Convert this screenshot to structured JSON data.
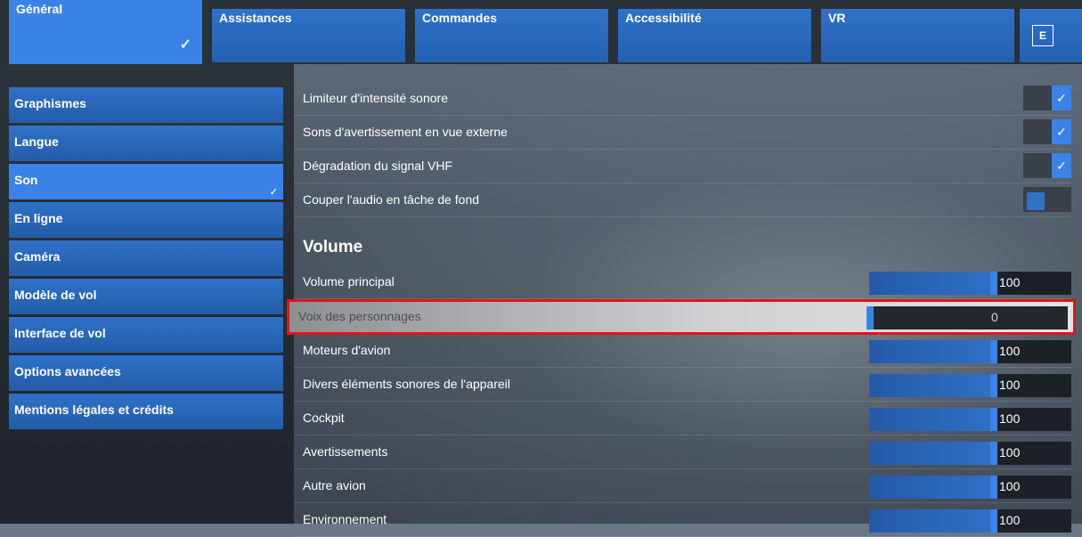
{
  "tabs": [
    {
      "label": "Général",
      "active": true
    },
    {
      "label": "Assistances"
    },
    {
      "label": "Commandes"
    },
    {
      "label": "Accessibilité"
    },
    {
      "label": "VR"
    }
  ],
  "tab_key": "E",
  "menu": [
    {
      "label": "Graphismes"
    },
    {
      "label": "Langue"
    },
    {
      "label": "Son",
      "active": true
    },
    {
      "label": "En ligne"
    },
    {
      "label": "Caméra"
    },
    {
      "label": "Modèle de vol"
    },
    {
      "label": "Interface de vol"
    },
    {
      "label": "Options avancées"
    },
    {
      "label": "Mentions légales et crédits"
    }
  ],
  "toggles": [
    {
      "label": "Limiteur d'intensité sonore",
      "on": true
    },
    {
      "label": "Sons d'avertissement en vue externe",
      "on": true
    },
    {
      "label": "Dégradation du signal VHF",
      "on": true
    },
    {
      "label": "Couper l'audio en tâche de fond",
      "on": false
    }
  ],
  "volume_title": "Volume",
  "sliders": [
    {
      "label": "Volume principal",
      "value": "100",
      "level": 100
    },
    {
      "label": "Voix des personnages",
      "value": "0",
      "level": 0,
      "highlighted": true
    },
    {
      "label": "Moteurs d'avion",
      "value": "100",
      "level": 100
    },
    {
      "label": "Divers éléments sonores de l'appareil",
      "value": "100",
      "level": 100
    },
    {
      "label": "Cockpit",
      "value": "100",
      "level": 100
    },
    {
      "label": "Avertissements",
      "value": "100",
      "level": 100
    },
    {
      "label": "Autre avion",
      "value": "100",
      "level": 100
    },
    {
      "label": "Environnement",
      "value": "100",
      "level": 100
    }
  ],
  "check_glyph": "✓",
  "colors": {
    "accent": "#3b82e6",
    "highlight_border": "#e21414"
  }
}
